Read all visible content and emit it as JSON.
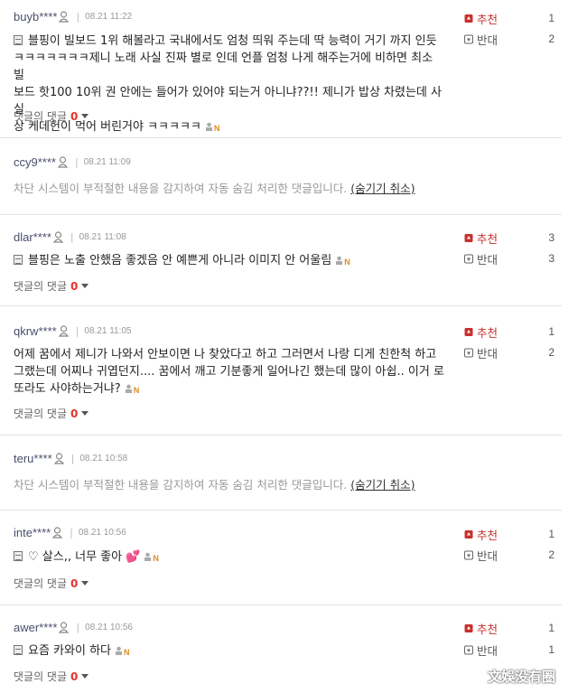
{
  "hidden_text": "차단 시스템이 부적절한 내용을 감지하여 자동 숨김 처리한 댓글입니다.",
  "undo_label": "(숨기기 취소)",
  "reply_label": "댓글의 댓글",
  "upvote_label": "추천",
  "downvote_label": "반대",
  "comments": [
    {
      "user": "buyb****",
      "date": "08.21 11:22",
      "lines": [
        "블핑이 빌보드 1위 해볼라고 국내에서도 엄청 띄워 주는데 딱 능력이 거기 까지 인듯",
        "ㅋㅋㅋㅋㅋㅋㅋ제니 노래 사실 진짜 별로 인데 언플 엄청 나게 해주는거에 비하면 최소 빌",
        "보드 핫100 10위 권 안에는 들어가 있어야 되는거 아니냐??!! 제니가 밥상 차렸는데 사실",
        "상 케데헌이 먹어 버린거야 ㅋㅋㅋㅋㅋ"
      ],
      "reply_count": "0",
      "up": "1",
      "down": "2"
    },
    {
      "user": "ccy9****",
      "date": "08.21 11:09"
    },
    {
      "user": "dlar****",
      "date": "08.21 11:08",
      "lines": [
        "블핑은 노출 안했음 좋겠음 안 예쁜게 아니라 이미지 안 어울림"
      ],
      "reply_count": "0",
      "up": "3",
      "down": "3"
    },
    {
      "user": "qkrw****",
      "date": "08.21 11:05",
      "lines": [
        "어제 꿈에서 제니가 나와서 안보이면 나 찾았다고 하고 그러면서 나랑 디게 친한척 하고",
        "그랬는데 어찌나 귀엽던지.... 꿈에서 깨고 기분좋게 일어나긴 했는데 많이 아쉽.. 이거 로",
        "또라도 사야하는거냐?"
      ],
      "reply_count": "0",
      "up": "1",
      "down": "2"
    },
    {
      "user": "teru****",
      "date": "08.21 10:58"
    },
    {
      "user": "inte****",
      "date": "08.21 10:56",
      "lines": [
        "♡ 살스,, 너무 좋아 💕"
      ],
      "reply_count": "0",
      "up": "1",
      "down": "2"
    },
    {
      "user": "awer****",
      "date": "08.21 10:56",
      "lines": [
        "요즘 카와이 하다"
      ],
      "reply_count": "0",
      "up": "1",
      "down": "1"
    }
  ],
  "watermark": "文娛没有圈",
  "icons": {
    "person": "person-icon",
    "doc": "doc-icon",
    "thumb_up": "thumb-up-icon",
    "thumb_down": "thumb-down-icon",
    "mobile": "mobile-badge-icon"
  },
  "colors": {
    "upvote": "#c9302c",
    "reply_count": "#e8322a",
    "username": "#4a4f6b"
  }
}
